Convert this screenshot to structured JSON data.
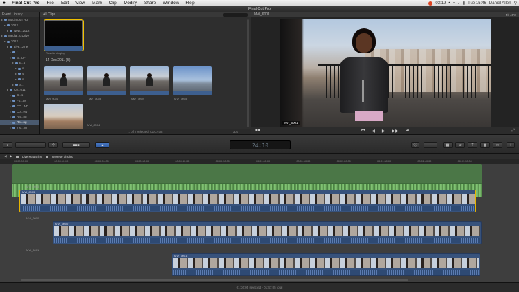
{
  "menubar": {
    "apple": "",
    "items": [
      "Final Cut Pro",
      "File",
      "Edit",
      "View",
      "Mark",
      "Clip",
      "Modify",
      "Share",
      "Window",
      "Help"
    ],
    "time_remaining": "03:19",
    "clock": "Tue 15:46",
    "user": "Daniel Allen"
  },
  "window_title": "Final Cut Pro",
  "library": {
    "header": "Event Library",
    "rows": [
      {
        "label": "Macintosh HD",
        "indent": 0,
        "selected": false
      },
      {
        "label": "2012",
        "indent": 1,
        "selected": false
      },
      {
        "label": "New...2012",
        "indent": 2,
        "selected": false
      },
      {
        "label": "Media...c Drive",
        "indent": 0,
        "selected": false
      },
      {
        "label": "2012",
        "indent": 1,
        "selected": false
      },
      {
        "label": "Live...zine",
        "indent": 2,
        "selected": false
      },
      {
        "label": "t",
        "indent": 3,
        "selected": false
      },
      {
        "label": "B...UF",
        "indent": 3,
        "selected": false
      },
      {
        "label": "E...t",
        "indent": 4,
        "selected": false
      },
      {
        "label": "s",
        "indent": 5,
        "selected": false
      },
      {
        "label": "s",
        "indent": 5,
        "selected": false
      },
      {
        "label": "s",
        "indent": 5,
        "selected": false
      },
      {
        "label": "S...",
        "indent": 4,
        "selected": false
      },
      {
        "label": "Co...011",
        "indent": 2,
        "selected": false
      },
      {
        "label": "C...s",
        "indent": 3,
        "selected": false
      },
      {
        "label": "Fo...gs",
        "indent": 3,
        "selected": false
      },
      {
        "label": "CO...ND",
        "indent": 3,
        "selected": false
      },
      {
        "label": "Co...ew",
        "indent": 3,
        "selected": false
      },
      {
        "label": "Ra...ng",
        "indent": 3,
        "selected": false
      },
      {
        "label": "Ro...ng",
        "indent": 3,
        "selected": true
      },
      {
        "label": "Ins...ng",
        "indent": 3,
        "selected": false
      }
    ]
  },
  "browser": {
    "header": "All Clips",
    "first_clip_caption": "Rosette singing",
    "date_group": "14 Dec 2011",
    "date_count": "(5)",
    "clips": [
      {
        "name": "MVI_6001"
      },
      {
        "name": "MVI_6003"
      },
      {
        "name": "MVI_6002"
      },
      {
        "name": "MVI_6005"
      },
      {
        "name": "MVI_6004"
      }
    ],
    "footer": "1 of 7 selected, 01:07:02",
    "duration": "30s"
  },
  "viewer": {
    "header": "MVI_6001",
    "zoom": "Fit",
    "percent": "40%",
    "clip_overlay": "MVI_6001"
  },
  "toolbar": {
    "timecode": "24:10",
    "buttons": [
      "",
      "",
      "",
      "",
      ""
    ]
  },
  "timeline": {
    "breadcrumb_project": "Live Magazine",
    "breadcrumb_clip": "Rosette singing",
    "ruler": [
      "00:00:00:00",
      "00:00:10:00",
      "00:00:20:00",
      "00:00:30:00",
      "00:00:40:00",
      "00:00:50:00",
      "00:01:00:00",
      "00:01:10:00",
      "00:01:20:00",
      "00:01:30:00",
      "00:01:40:00",
      "00:01:50:00"
    ],
    "tracks": [
      {
        "name": "MVI_6003",
        "clip": "MVI_6003"
      },
      {
        "name": "MVI_6000",
        "clip": "MVI_6000"
      },
      {
        "name": "MVI_6001",
        "clip": "MVI_6001"
      }
    ],
    "footer": "01:36:05 selected - 01:47:05 total"
  }
}
